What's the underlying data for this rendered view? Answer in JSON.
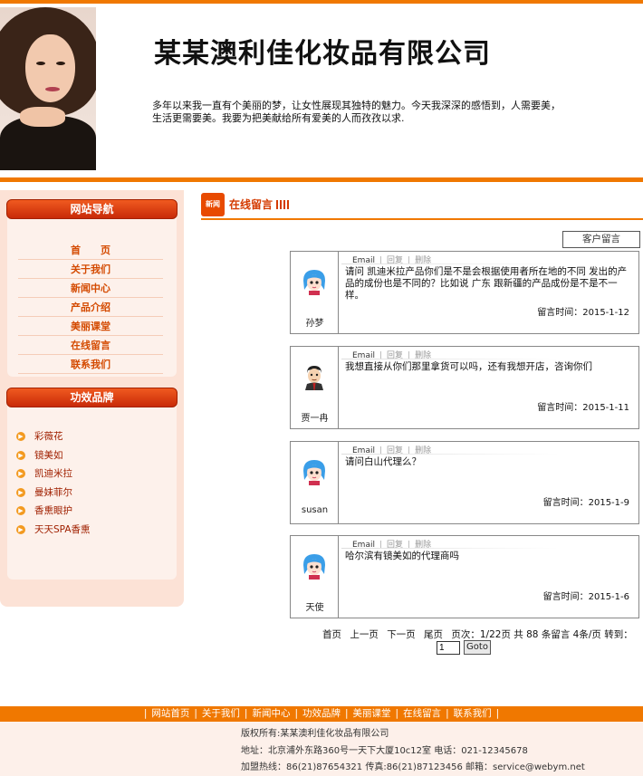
{
  "header": {
    "company": "某某澳利佳化妆品有限公司",
    "slogan": "多年以来我一直有个美丽的梦，让女性展现其独特的魅力。今天我深深的感悟到，人需要美，生活更需要美。我要为把美献给所有爱美的人而孜孜以求."
  },
  "sidebar": {
    "nav_title": "网站导航",
    "nav": [
      "首　　页",
      "关于我们",
      "新闻中心",
      "产品介绍",
      "美丽课堂",
      "在线留言",
      "联系我们"
    ],
    "brand_title": "功效品牌",
    "brands": [
      "彩薇花",
      "镜美如",
      "凯迪米拉",
      "曼妹菲尔",
      "香熏眼护",
      "天天SPA香熏"
    ]
  },
  "main": {
    "section_icon": "新闻",
    "section_title": "在线留言",
    "customer_button": "客户留言",
    "ops": {
      "email": "Email",
      "reply": "回复",
      "delete": "删除"
    },
    "time_label": "留言时间：",
    "messages": [
      {
        "user": "孙梦",
        "avatar": "girl-avatar-icon",
        "content": "请问 凯迪米拉产品你们是不是会根据使用者所在地的不同 发出的产品的成份也是不同的？比如说 广东 跟新疆的产品成份是不是不一样。",
        "time": "2015-1-12"
      },
      {
        "user": "贾一冉",
        "avatar": "man-avatar-icon",
        "content": "我想直接从你们那里拿货可以吗，还有我想开店，咨询你们",
        "time": "2015-1-11"
      },
      {
        "user": "susan",
        "avatar": "girl-avatar-icon",
        "content": "请问白山代理么？",
        "time": "2015-1-9"
      },
      {
        "user": "天使",
        "avatar": "girl-avatar-icon",
        "content": "哈尔滨有镜美如的代理商吗",
        "time": "2015-1-6"
      }
    ],
    "pager": {
      "first": "首页",
      "prev": "上一页",
      "next": "下一页",
      "last": "尾页",
      "status": "页次：1/22页 共 88 条留言 4条/页 转到：",
      "input_value": "1",
      "goto": "Goto"
    }
  },
  "footer": {
    "nav": [
      "网站首页",
      "关于我们",
      "新闻中心",
      "功效品牌",
      "美丽课堂",
      "在线留言",
      "联系我们"
    ],
    "copyright": "版权所有:某某澳利佳化妆品有限公司",
    "address": "地址：北京浦外东路360号一天下大厦10c12室 电话：021-12345678",
    "hotline": "加盟热线：86(21)87654321  传真:86(21)87123456 邮箱：service@webym.net"
  },
  "colors": {
    "accent": "#f07800",
    "nav_text": "#d44a00",
    "header_red": "#c82a08"
  }
}
